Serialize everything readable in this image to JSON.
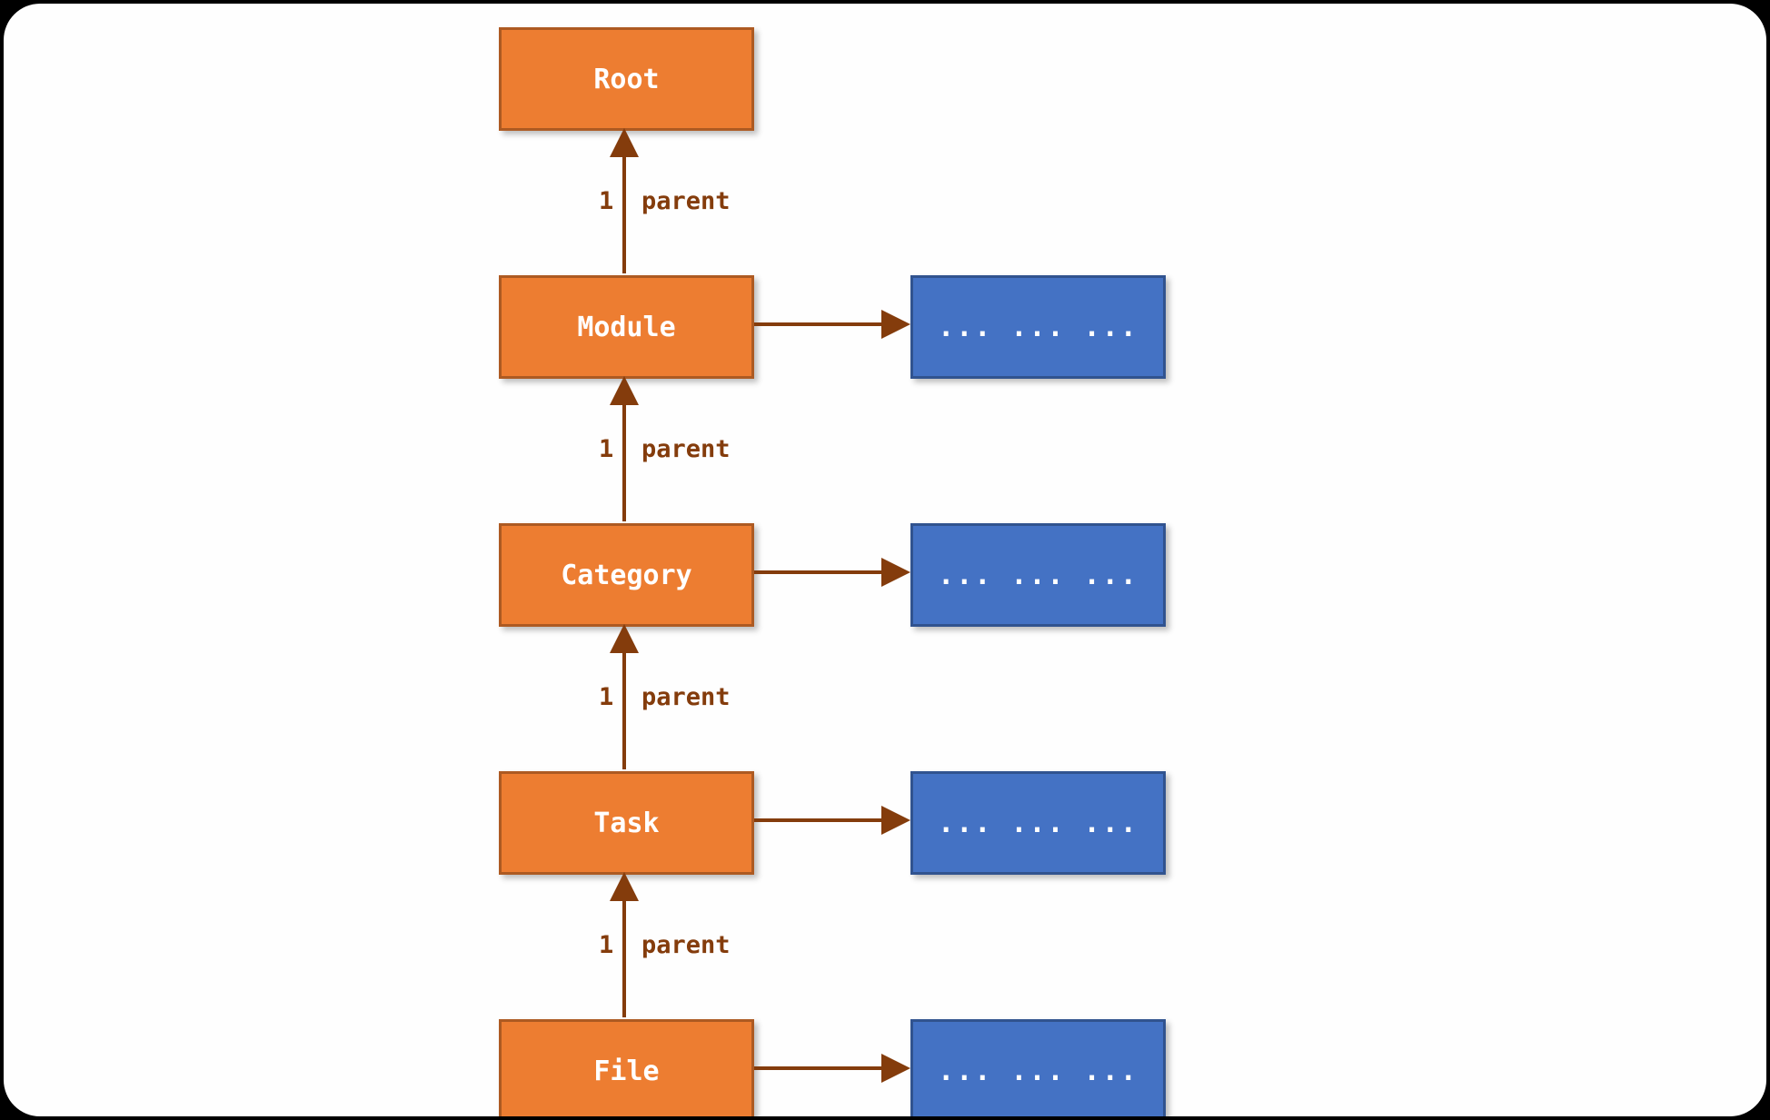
{
  "diagram": {
    "nodes": {
      "root": "Root",
      "module": "Module",
      "category": "Category",
      "task": "Task",
      "file": "File",
      "ellipsis": "... ... ..."
    },
    "edge": {
      "count": "1",
      "label": "parent"
    }
  }
}
